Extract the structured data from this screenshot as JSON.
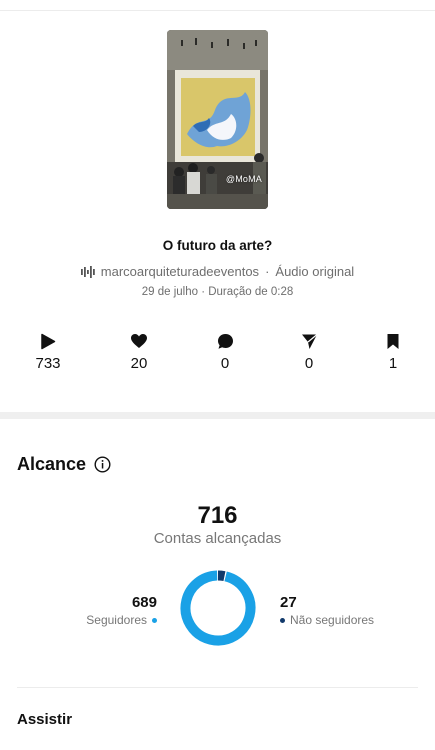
{
  "reel": {
    "title": "O futuro da arte?",
    "author": "marcoarquiteturadeeventos",
    "audio": "Áudio original",
    "date_duration": "29 de julho · Duração de 0:28",
    "thumbnail_watermark": "@MoMA"
  },
  "stats": [
    {
      "icon": "play-icon",
      "value": "733"
    },
    {
      "icon": "heart-icon",
      "value": "20"
    },
    {
      "icon": "comment-icon",
      "value": "0"
    },
    {
      "icon": "share-icon",
      "value": "0"
    },
    {
      "icon": "bookmark-icon",
      "value": "1"
    }
  ],
  "reach": {
    "title": "Alcance",
    "total": "716",
    "total_label": "Contas alcançadas",
    "followers_value": "689",
    "followers_label": "Seguidores",
    "non_followers_value": "27",
    "non_followers_label": "Não seguidores",
    "followers_count": 689,
    "non_followers_count": 27,
    "colors": {
      "followers": "#1aa1e6",
      "non_followers": "#123a6b"
    }
  },
  "next_section": {
    "title": "Assistir"
  }
}
